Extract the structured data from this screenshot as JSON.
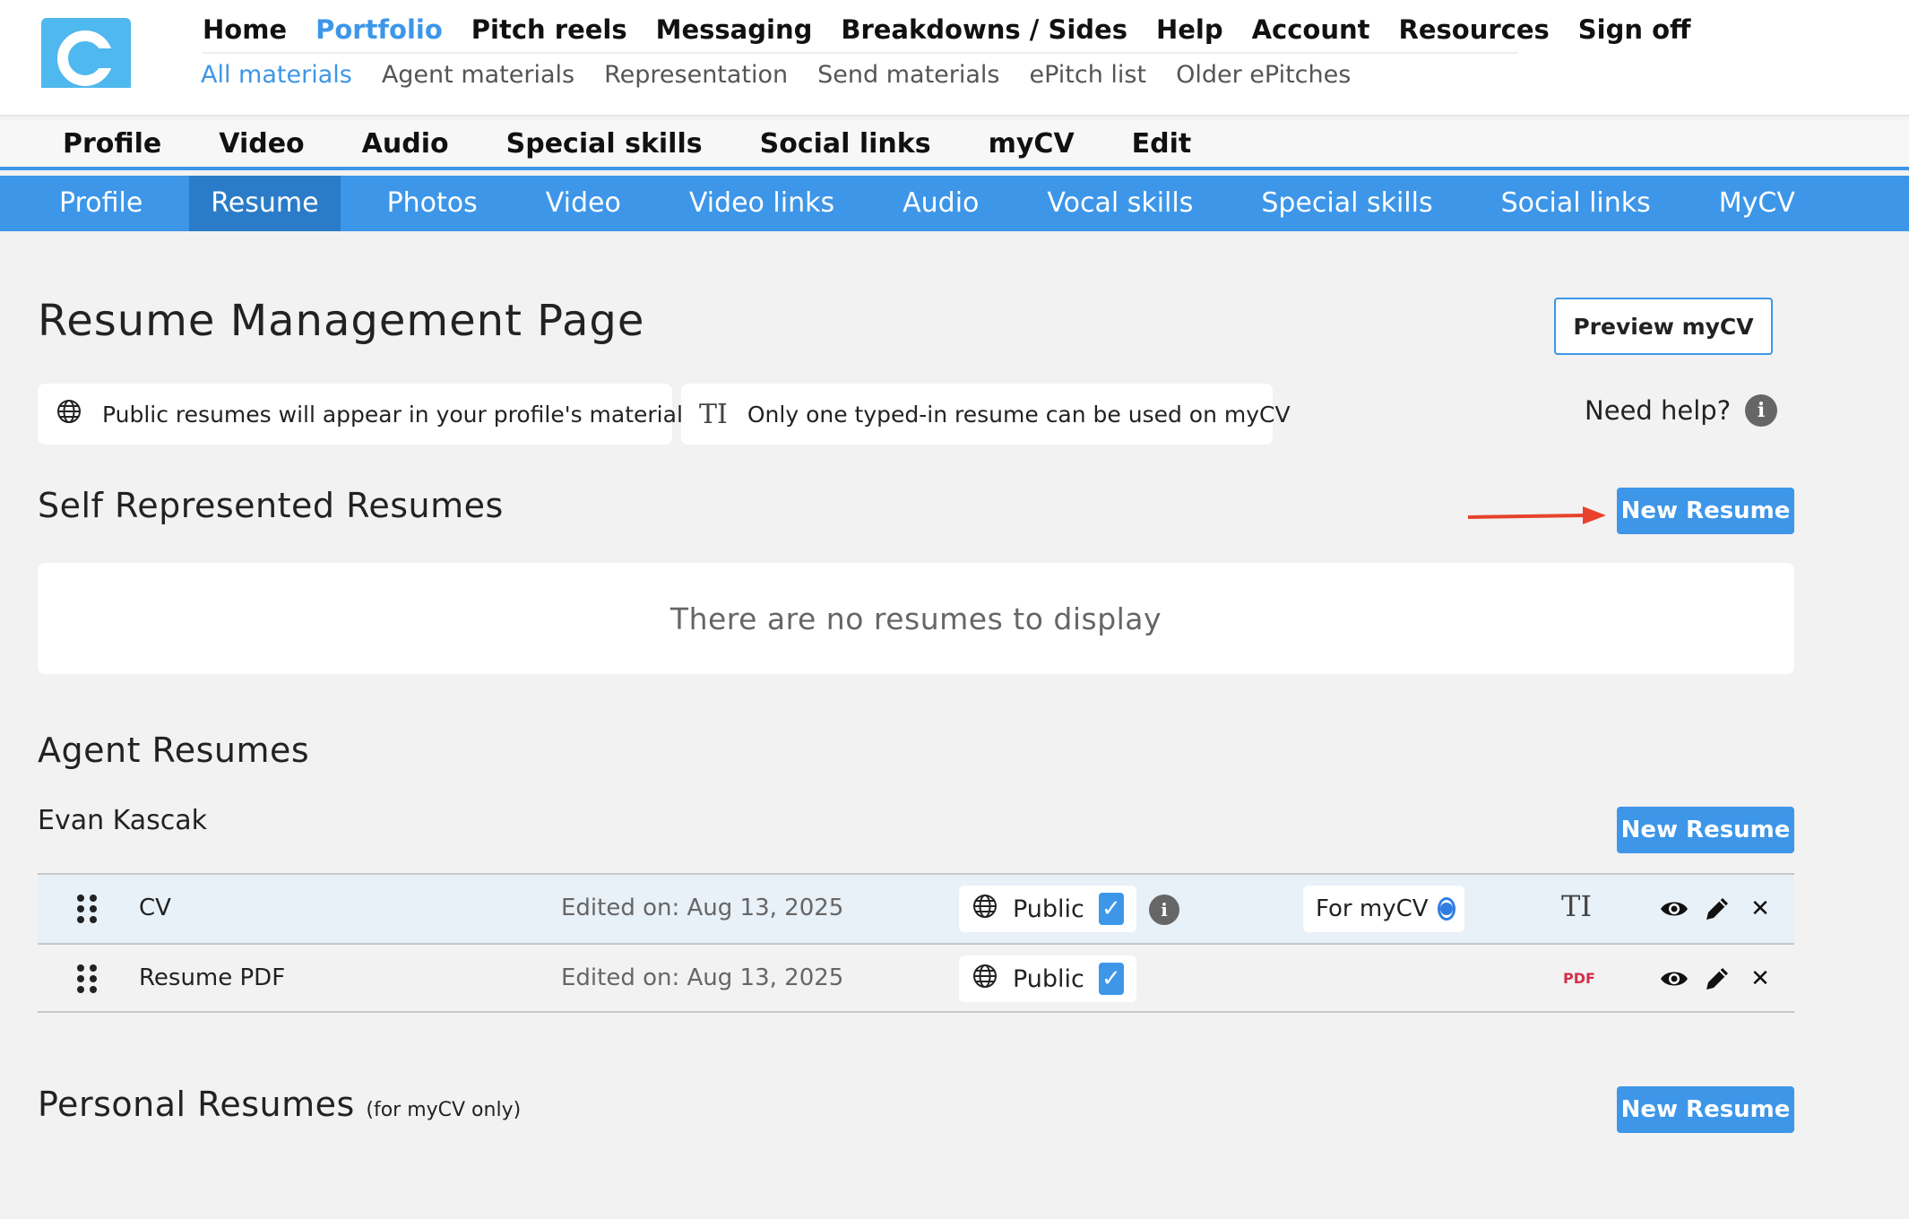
{
  "header": {
    "logo_letter": "C",
    "main_nav": [
      "Home",
      "Portfolio",
      "Pitch reels",
      "Messaging",
      "Breakdowns / Sides",
      "Help",
      "Account",
      "Resources",
      "Sign off"
    ],
    "main_nav_active": "Portfolio",
    "sub_nav": [
      "All materials",
      "Agent materials",
      "Representation",
      "Send materials",
      "ePitch list",
      "Older ePitches"
    ],
    "sub_nav_active": "All materials"
  },
  "tabs": [
    "Profile",
    "Video",
    "Audio",
    "Special skills",
    "Social links",
    "myCV",
    "Edit"
  ],
  "subtabs": [
    "Profile",
    "Resume",
    "Photos",
    "Video",
    "Video links",
    "Audio",
    "Vocal skills",
    "Special skills",
    "Social links",
    "MyCV"
  ],
  "subtabs_active": "Resume",
  "page": {
    "title": "Resume Management Page",
    "preview_button": "Preview myCV",
    "info_public": "Public resumes will appear in your profile's materials",
    "info_typed": "Only one typed-in resume can be used on myCV",
    "typed_icon": "TI",
    "need_help": "Need help?",
    "help_icon_glyph": "i"
  },
  "self_represented": {
    "title": "Self Represented Resumes",
    "new_button": "New Resume",
    "empty_text": "There are no resumes to display"
  },
  "agent_resumes": {
    "title": "Agent Resumes",
    "agent_name": "Evan Kascak",
    "new_button": "New Resume",
    "rows": [
      {
        "name": "CV",
        "edited": "Edited on: Aug 13, 2025",
        "visibility": "Public",
        "for_mycv": "For myCV",
        "type_icon": "TI",
        "highlighted": true
      },
      {
        "name": "Resume PDF",
        "edited": "Edited on: Aug 13, 2025",
        "visibility": "Public",
        "type_icon": "PDF",
        "highlighted": false
      }
    ]
  },
  "personal": {
    "title": "Personal Resumes",
    "subtitle": "(for myCV only)",
    "new_button": "New Resume"
  },
  "colors": {
    "accent": "#3d96e8",
    "arrow": "#e8422c",
    "pdf": "#d0304a"
  }
}
